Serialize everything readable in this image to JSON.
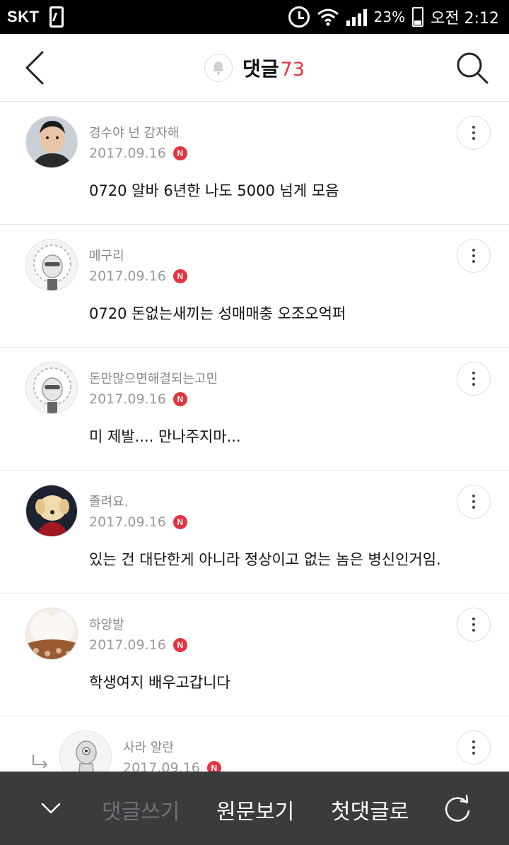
{
  "status_bar": {
    "carrier": "SKT",
    "battery_percent": "23%",
    "time": "오전 2:12"
  },
  "header": {
    "title": "댓글",
    "count": "73"
  },
  "comments": [
    {
      "author": "경수야 넌 감자해",
      "date": "2017.09.16",
      "badge": "N",
      "text": "0720 알바 6년한 나도 5000 넘게 모음",
      "avatar": "person-photo"
    },
    {
      "author": "메구리",
      "date": "2017.09.16",
      "badge": "N",
      "text": "0720 돈없는새끼는 성매매충 오조오억퍼",
      "avatar": "default-character"
    },
    {
      "author": "돈만많으면해결되는고민",
      "date": "2017.09.16",
      "badge": "N",
      "text": "미 제발.... 만나주지마...",
      "avatar": "default-character"
    },
    {
      "author": "졸려요.",
      "date": "2017.09.16",
      "badge": "N",
      "text": "있는 건 대단한게 아니라 정상이고 없는 놈은 병신인거임.",
      "avatar": "dog-photo"
    },
    {
      "author": "하양발",
      "date": "2017.09.16",
      "badge": "N",
      "text": "학생여지 배우고갑니다",
      "avatar": "fur-photo"
    },
    {
      "author": "사라 알란",
      "date": "2017.09.16",
      "badge": "N",
      "text": "",
      "avatar": "alien-character",
      "is_reply": true
    }
  ],
  "bottom_bar": {
    "write_comment": "댓글쓰기",
    "view_original": "원문보기",
    "first_comment": "첫댓글로"
  },
  "colors": {
    "accent_red": "#e53340",
    "bottom_bar_bg": "#3a3b3d",
    "disabled_text": "#6f7073"
  }
}
